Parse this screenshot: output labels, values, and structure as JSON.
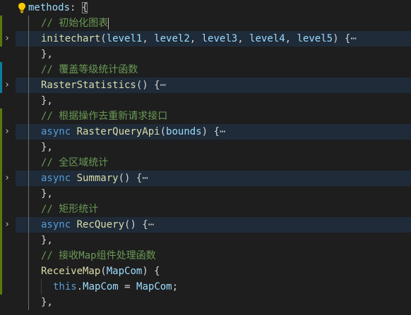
{
  "editor": {
    "language": "javascript",
    "colors": {
      "background": "#1e1e1e",
      "keyword": "#569cd6",
      "function": "#dcdcaa",
      "variable": "#9cdcfe",
      "comment": "#6a9955",
      "git_added": "#587c0c",
      "git_modified": "#0c7d9d"
    },
    "lines": [
      {
        "id": "l0",
        "tokens": [
          {
            "t": "var",
            "v": "methods"
          },
          {
            "t": "pn",
            "v": ": "
          },
          {
            "t": "pn",
            "v": "{",
            "hl": true
          }
        ]
      },
      {
        "id": "l1",
        "tokens": [
          {
            "t": "cm",
            "v": "// 初始化图表"
          }
        ]
      },
      {
        "id": "l2",
        "folded": true,
        "tokens": [
          {
            "t": "fn",
            "v": "initechart"
          },
          {
            "t": "pn",
            "v": "("
          },
          {
            "t": "var",
            "v": "level1"
          },
          {
            "t": "pn",
            "v": ", "
          },
          {
            "t": "var",
            "v": "level2"
          },
          {
            "t": "pn",
            "v": ", "
          },
          {
            "t": "var",
            "v": "level3"
          },
          {
            "t": "pn",
            "v": ", "
          },
          {
            "t": "var",
            "v": "level4"
          },
          {
            "t": "pn",
            "v": ", "
          },
          {
            "t": "var",
            "v": "level5"
          },
          {
            "t": "pn",
            "v": ") {"
          }
        ]
      },
      {
        "id": "l3",
        "tokens": [
          {
            "t": "pn",
            "v": "},"
          }
        ]
      },
      {
        "id": "l4",
        "tokens": [
          {
            "t": "cm",
            "v": "// 覆盖等级统计函数"
          }
        ]
      },
      {
        "id": "l5",
        "folded": true,
        "tokens": [
          {
            "t": "fn",
            "v": "RasterStatistics"
          },
          {
            "t": "pn",
            "v": "() {"
          }
        ]
      },
      {
        "id": "l6",
        "tokens": [
          {
            "t": "pn",
            "v": "},"
          }
        ]
      },
      {
        "id": "l7",
        "tokens": [
          {
            "t": "cm",
            "v": "// 根据操作去重新请求接口"
          }
        ]
      },
      {
        "id": "l8",
        "folded": true,
        "tokens": [
          {
            "t": "kw",
            "v": "async "
          },
          {
            "t": "fn",
            "v": "RasterQueryApi"
          },
          {
            "t": "pn",
            "v": "("
          },
          {
            "t": "var",
            "v": "bounds"
          },
          {
            "t": "pn",
            "v": ") {"
          }
        ]
      },
      {
        "id": "l9",
        "tokens": [
          {
            "t": "pn",
            "v": "},"
          }
        ]
      },
      {
        "id": "l10",
        "tokens": [
          {
            "t": "cm",
            "v": "// 全区域统计"
          }
        ]
      },
      {
        "id": "l11",
        "folded": true,
        "tokens": [
          {
            "t": "kw",
            "v": "async "
          },
          {
            "t": "fn",
            "v": "Summary"
          },
          {
            "t": "pn",
            "v": "() {"
          }
        ]
      },
      {
        "id": "l12",
        "tokens": [
          {
            "t": "pn",
            "v": "},"
          }
        ]
      },
      {
        "id": "l13",
        "tokens": [
          {
            "t": "cm",
            "v": "// 矩形统计"
          }
        ]
      },
      {
        "id": "l14",
        "folded": true,
        "tokens": [
          {
            "t": "kw",
            "v": "async "
          },
          {
            "t": "fn",
            "v": "RecQuery"
          },
          {
            "t": "pn",
            "v": "() {"
          }
        ]
      },
      {
        "id": "l15",
        "tokens": [
          {
            "t": "pn",
            "v": "},"
          }
        ]
      },
      {
        "id": "l16",
        "tokens": [
          {
            "t": "cm",
            "v": "// 接收Map组件处理函数"
          }
        ]
      },
      {
        "id": "l17",
        "tokens": [
          {
            "t": "fn",
            "v": "ReceiveMap"
          },
          {
            "t": "pn",
            "v": "("
          },
          {
            "t": "var",
            "v": "MapCom"
          },
          {
            "t": "pn",
            "v": ") {"
          }
        ]
      },
      {
        "id": "l18",
        "tokens": [
          {
            "t": "kw",
            "v": "this"
          },
          {
            "t": "pn",
            "v": "."
          },
          {
            "t": "var",
            "v": "MapCom"
          },
          {
            "t": "pn",
            "v": " = "
          },
          {
            "t": "var",
            "v": "MapCom"
          },
          {
            "t": "pn",
            "v": ";"
          }
        ]
      },
      {
        "id": "l19",
        "tokens": [
          {
            "t": "pn",
            "v": "},"
          }
        ]
      }
    ],
    "ellipsis": "⋯",
    "fold_icon": "chevron-right-icon",
    "lightbulb_icon": "lightbulb-icon"
  }
}
